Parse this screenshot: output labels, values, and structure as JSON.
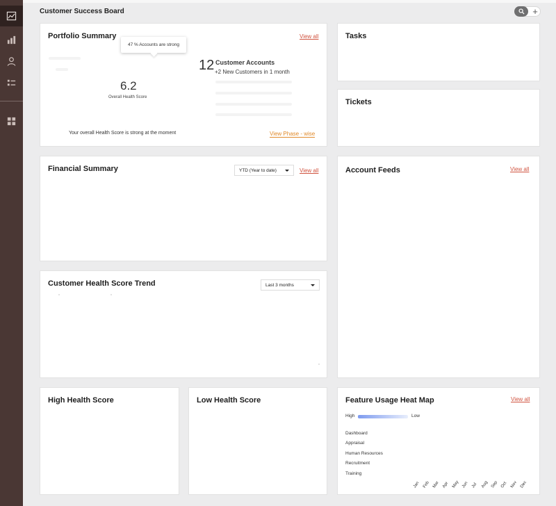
{
  "board_title": "Customer Success Board",
  "colors": {
    "sidebar": "#4a3734",
    "accent_link": "#d0533f",
    "phase_link": "#e08a2a",
    "heatmap_high": "#7e9bef"
  },
  "sidebar_items": [
    {
      "icon": "line-chart-icon"
    },
    {
      "icon": "bar-chart-icon"
    },
    {
      "icon": "user-icon"
    },
    {
      "icon": "list-icon"
    },
    {
      "icon": "grid-icon"
    }
  ],
  "portfolio": {
    "title": "Portfolio Summary",
    "view_all": "View all",
    "tooltip": "47 % Accounts are strong",
    "health_score": "6.2",
    "health_label": "Overall Health Score",
    "accounts_count": "12",
    "accounts_title": "Customer Accounts",
    "accounts_sub": "+2 New Customers in 1 month",
    "note": "Your overall Health Score is strong at the moment",
    "phase_link": "View  Phase - wise"
  },
  "tasks": {
    "title": "Tasks"
  },
  "tickets": {
    "title": "Tickets"
  },
  "financial": {
    "title": "Financial Summary",
    "period": "YTD (Year to date)",
    "view_all": "View all"
  },
  "feeds": {
    "title": "Account Feeds",
    "view_all": "View all"
  },
  "trend": {
    "title": "Customer Health Score Trend",
    "period": "Last 3 months"
  },
  "high_health": {
    "title": "High Health Score"
  },
  "low_health": {
    "title": "Low Health Score"
  },
  "heatmap": {
    "title": "Feature Usage Heat Map",
    "view_all": "View all",
    "legend_high": "High",
    "legend_low": "Low",
    "rows": [
      "Dashboard",
      "Appraisal",
      "Human Resources",
      "Recruitment",
      "Training"
    ],
    "months": [
      "Jan",
      "Feb",
      "Mar",
      "Apr",
      "May",
      "Jun",
      "Jul",
      "Aug",
      "Sep",
      "Oct",
      "Nov",
      "Dec"
    ]
  }
}
